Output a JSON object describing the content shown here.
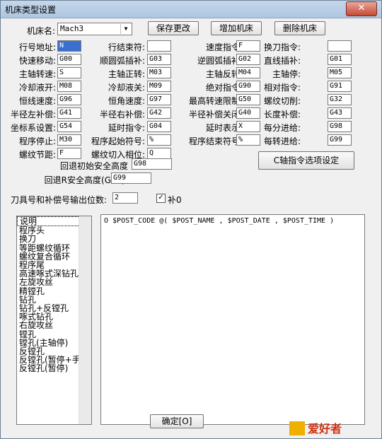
{
  "window": {
    "title": "机床类型设置",
    "close": "✕"
  },
  "machine": {
    "label": "机床名:",
    "value": "Mach3",
    "save": "保存更改",
    "add": "增加机床",
    "delete": "删除机床"
  },
  "fields": [
    {
      "label": "行号地址:",
      "value": "N",
      "selected": true
    },
    {
      "label": "行结束符:",
      "value": ""
    },
    {
      "label": "速度指令:",
      "value": "F"
    },
    {
      "label": "换刀指令:",
      "value": ""
    },
    {
      "label": "快速移动:",
      "value": "G00"
    },
    {
      "label": "顺圆弧插补:",
      "value": "G03"
    },
    {
      "label": "逆圆弧插补:",
      "value": "G02"
    },
    {
      "label": "直线插补:",
      "value": "G01"
    },
    {
      "label": "主轴转速:",
      "value": "S"
    },
    {
      "label": "主轴正转:",
      "value": "M03"
    },
    {
      "label": "主轴反转:",
      "value": "M04"
    },
    {
      "label": "主轴停:",
      "value": "M05"
    },
    {
      "label": "冷却液开:",
      "value": "M08"
    },
    {
      "label": "冷却液关:",
      "value": "M09"
    },
    {
      "label": "绝对指令:",
      "value": "G90"
    },
    {
      "label": "相对指令:",
      "value": "G91"
    },
    {
      "label": "恒线速度:",
      "value": "G96"
    },
    {
      "label": "恒角速度:",
      "value": "G97"
    },
    {
      "label": "最高转速限制:",
      "value": "G50"
    },
    {
      "label": "螺纹切削:",
      "value": "G32"
    },
    {
      "label": "半径左补偿:",
      "value": "G41"
    },
    {
      "label": "半径右补偿:",
      "value": "G42"
    },
    {
      "label": "半径补偿关闭:",
      "value": "G40"
    },
    {
      "label": "长度补偿:",
      "value": "G43"
    },
    {
      "label": "坐标系设置:",
      "value": "G54"
    },
    {
      "label": "延时指令:",
      "value": "G04"
    },
    {
      "label": "延时表示:",
      "value": "X"
    },
    {
      "label": "每分进给:",
      "value": "G98"
    },
    {
      "label": "程序停止:",
      "value": "M30"
    },
    {
      "label": "程序起始符号:",
      "value": "%"
    },
    {
      "label": "程序结束符号:",
      "value": "%"
    },
    {
      "label": "每转进给:",
      "value": "G99"
    },
    {
      "label": "螺纹节距:",
      "value": "F"
    },
    {
      "label": "螺纹切入相位:",
      "value": "Q"
    }
  ],
  "c_axis_button": "C轴指令选项设定",
  "safe": [
    {
      "label": "回退初始安全高度",
      "value": "G98"
    },
    {
      "label": "回退R安全高度(G99):",
      "value": "G99"
    }
  ],
  "tool_digits": {
    "label": "刀具号和补偿号输出位数:",
    "value": "2",
    "check_label": "补0",
    "checked": true,
    "mark": "✓"
  },
  "list_items": [
    "说明",
    "程序头",
    "换刀",
    "等距螺纹循环",
    "螺纹复合循环",
    "程序尾",
    "高速啄式深钻孔",
    "左旋攻丝",
    "精镗孔",
    "钻孔",
    "钻孔+反镗孔",
    "啄式钻孔",
    "右旋攻丝",
    "镗孔",
    "镗孔(主轴停)",
    "反镗孔",
    "反镗孔(暂停+手动)",
    "反镗孔(暂停)"
  ],
  "editor_text": "O $POST_CODE @( $POST_NAME , $POST_DATE , $POST_TIME )",
  "ok_button": "确定[O]",
  "watermark": "爱好者"
}
